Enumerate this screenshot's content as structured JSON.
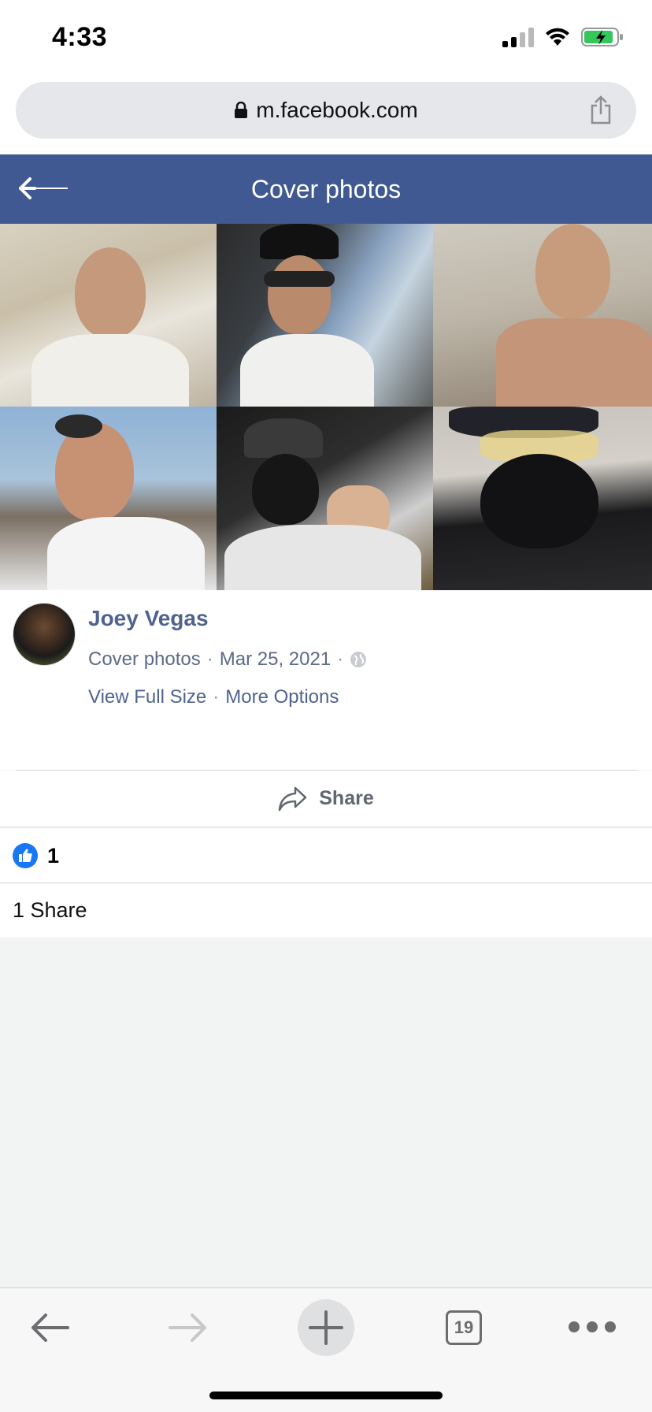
{
  "status_bar": {
    "time": "4:33"
  },
  "browser": {
    "url": "m.facebook.com",
    "tabs_count": "19"
  },
  "header": {
    "title": "Cover photos"
  },
  "post": {
    "author": "Joey Vegas",
    "album": "Cover photos",
    "date": "Mar 25, 2021",
    "separator": "·",
    "view_full_size": "View Full Size",
    "more_options": "More Options",
    "share_label": "Share",
    "like_count": "1",
    "shares_text": "1 Share"
  },
  "colors": {
    "fb_header": "#405993",
    "link": "#4f6290",
    "like_blue": "#1877f2"
  }
}
